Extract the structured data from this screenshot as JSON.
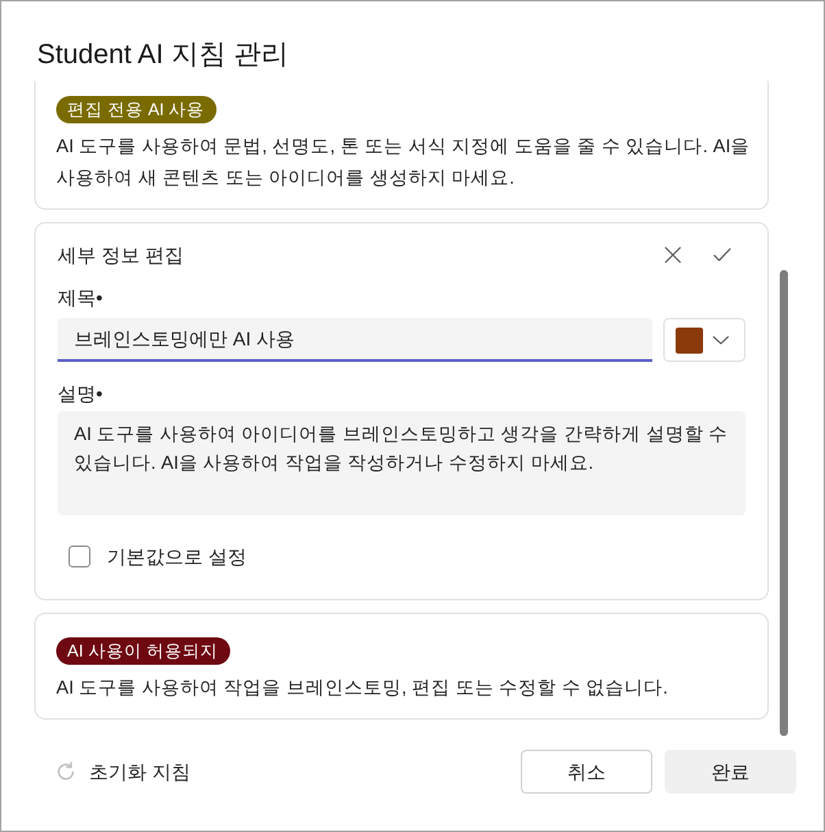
{
  "dialog": {
    "title": "Student AI 지침 관리"
  },
  "guidelines": [
    {
      "kind": "view",
      "cut_off_top": true,
      "label": "편집 전용 AI 사용",
      "color": "#7a6b00",
      "description": "AI 도구를 사용하여 문법, 선명도, 톤 또는 서식 지정에 도움을 줄 수 있습니다. AI을 사용하여 새 콘텐츠 또는 아이디어를 생성하지 마세요."
    },
    {
      "kind": "edit",
      "heading": "세부 정보 편집",
      "title_field": {
        "label": "제목•",
        "value": "브레인스토밍에만 AI 사용"
      },
      "color": "#8a3a0b",
      "description_field": {
        "label": "설명•",
        "value": "AI 도구를 사용하여 아이디어를 브레인스토밍하고 생각을 간략하게 설명할 수 있습니다. AI을 사용하여 작업을 작성하거나 수정하지 마세요."
      },
      "default_checkbox": {
        "label": "기본값으로 설정",
        "checked": false
      }
    },
    {
      "kind": "view",
      "cut_off_top": false,
      "label": "AI 사용이 허용되지",
      "color": "#6e0811",
      "description": "AI 도구를 사용하여 작업을 브레인스토밍, 편집 또는 수정할 수 없습니다."
    }
  ],
  "reset_link": {
    "label": "초기화 지침"
  },
  "buttons": [
    {
      "label": "취소",
      "kind": "outline"
    },
    {
      "label": "완료",
      "kind": "filled"
    }
  ]
}
